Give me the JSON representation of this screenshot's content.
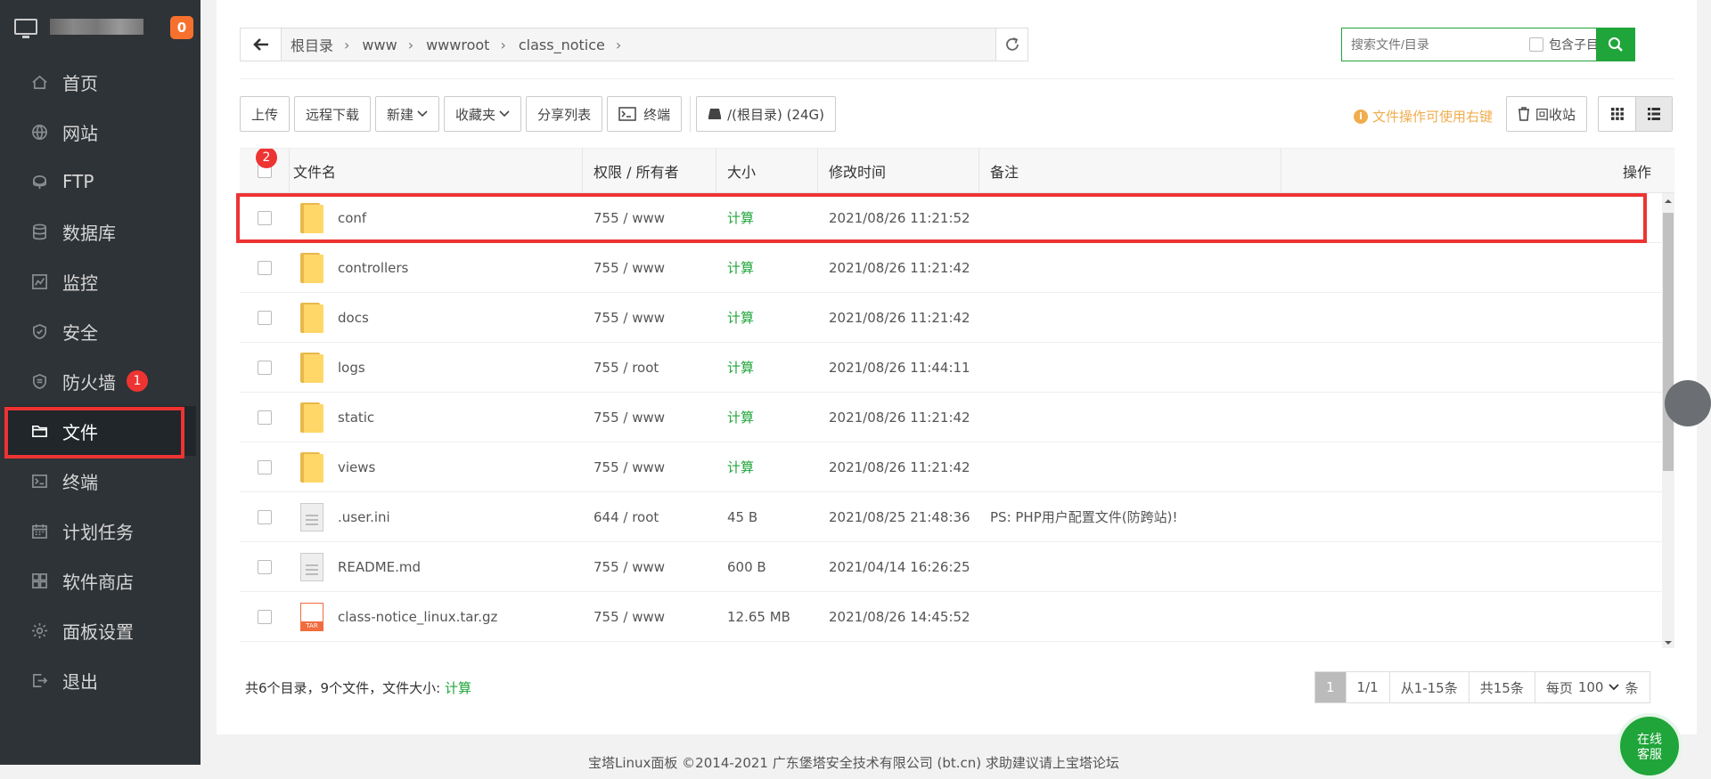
{
  "sidebar": {
    "badge": "0",
    "items": [
      {
        "label": "首页",
        "icon": "home-icon"
      },
      {
        "label": "网站",
        "icon": "globe-icon"
      },
      {
        "label": "FTP",
        "icon": "ftp-icon"
      },
      {
        "label": "数据库",
        "icon": "database-icon"
      },
      {
        "label": "监控",
        "icon": "monitor-chart-icon"
      },
      {
        "label": "安全",
        "icon": "shield-icon"
      },
      {
        "label": "防火墙",
        "icon": "firewall-icon",
        "badge": "1"
      },
      {
        "label": "文件",
        "icon": "folder-icon",
        "active": true
      },
      {
        "label": "终端",
        "icon": "terminal-icon"
      },
      {
        "label": "计划任务",
        "icon": "calendar-icon"
      },
      {
        "label": "软件商店",
        "icon": "apps-icon"
      },
      {
        "label": "面板设置",
        "icon": "gear-icon"
      },
      {
        "label": "退出",
        "icon": "logout-icon"
      }
    ]
  },
  "breadcrumb": [
    "根目录",
    "www",
    "wwwroot",
    "class_notice"
  ],
  "search": {
    "placeholder": "搜索文件/目录",
    "include_sub": "包含子目录"
  },
  "toolbar": {
    "upload": "上传",
    "remote_download": "远程下载",
    "new": "新建",
    "favorites": "收藏夹",
    "share_list": "分享列表",
    "terminal": "终端",
    "disk": "/(根目录) (24G)",
    "tip": "文件操作可使用右键",
    "recycle": "回收站"
  },
  "table": {
    "header_badge": "2",
    "columns": [
      "文件名",
      "权限 / 所有者",
      "大小",
      "修改时间",
      "备注",
      "操作"
    ],
    "rows": [
      {
        "type": "folder",
        "name": "conf",
        "perm": "755 / www",
        "size": "计算",
        "time": "2021/08/26 11:21:52",
        "note": ""
      },
      {
        "type": "folder",
        "name": "controllers",
        "perm": "755 / www",
        "size": "计算",
        "time": "2021/08/26 11:21:42",
        "note": ""
      },
      {
        "type": "folder",
        "name": "docs",
        "perm": "755 / www",
        "size": "计算",
        "time": "2021/08/26 11:21:42",
        "note": ""
      },
      {
        "type": "folder",
        "name": "logs",
        "perm": "755 / root",
        "size": "计算",
        "time": "2021/08/26 11:44:11",
        "note": ""
      },
      {
        "type": "folder",
        "name": "static",
        "perm": "755 / www",
        "size": "计算",
        "time": "2021/08/26 11:21:42",
        "note": ""
      },
      {
        "type": "folder",
        "name": "views",
        "perm": "755 / www",
        "size": "计算",
        "time": "2021/08/26 11:21:42",
        "note": ""
      },
      {
        "type": "file",
        "name": ".user.ini",
        "perm": "644 / root",
        "size": "45 B",
        "time": "2021/08/25 21:48:36",
        "note": "PS: PHP用户配置文件(防跨站)!"
      },
      {
        "type": "file",
        "name": "README.md",
        "perm": "755 / www",
        "size": "600 B",
        "time": "2021/04/14 16:26:25",
        "note": ""
      },
      {
        "type": "tar",
        "name": "class-notice_linux.tar.gz",
        "perm": "755 / www",
        "size": "12.65 MB",
        "time": "2021/08/26 14:45:52",
        "note": ""
      }
    ]
  },
  "summary": {
    "text": "共6个目录，9个文件，文件大小:",
    "calc": "计算"
  },
  "pager": {
    "page": "1",
    "pages": "1/1",
    "range": "从1-15条",
    "total": "共15条",
    "per_page_label": "每页",
    "per_page": "100",
    "unit": "条"
  },
  "footer_text": "宝塔Linux面板 ©2014-2021 广东堡塔安全技术有限公司 (bt.cn)  求助建议请上宝塔论坛",
  "chat": {
    "line1": "在线",
    "line2": "客服"
  }
}
